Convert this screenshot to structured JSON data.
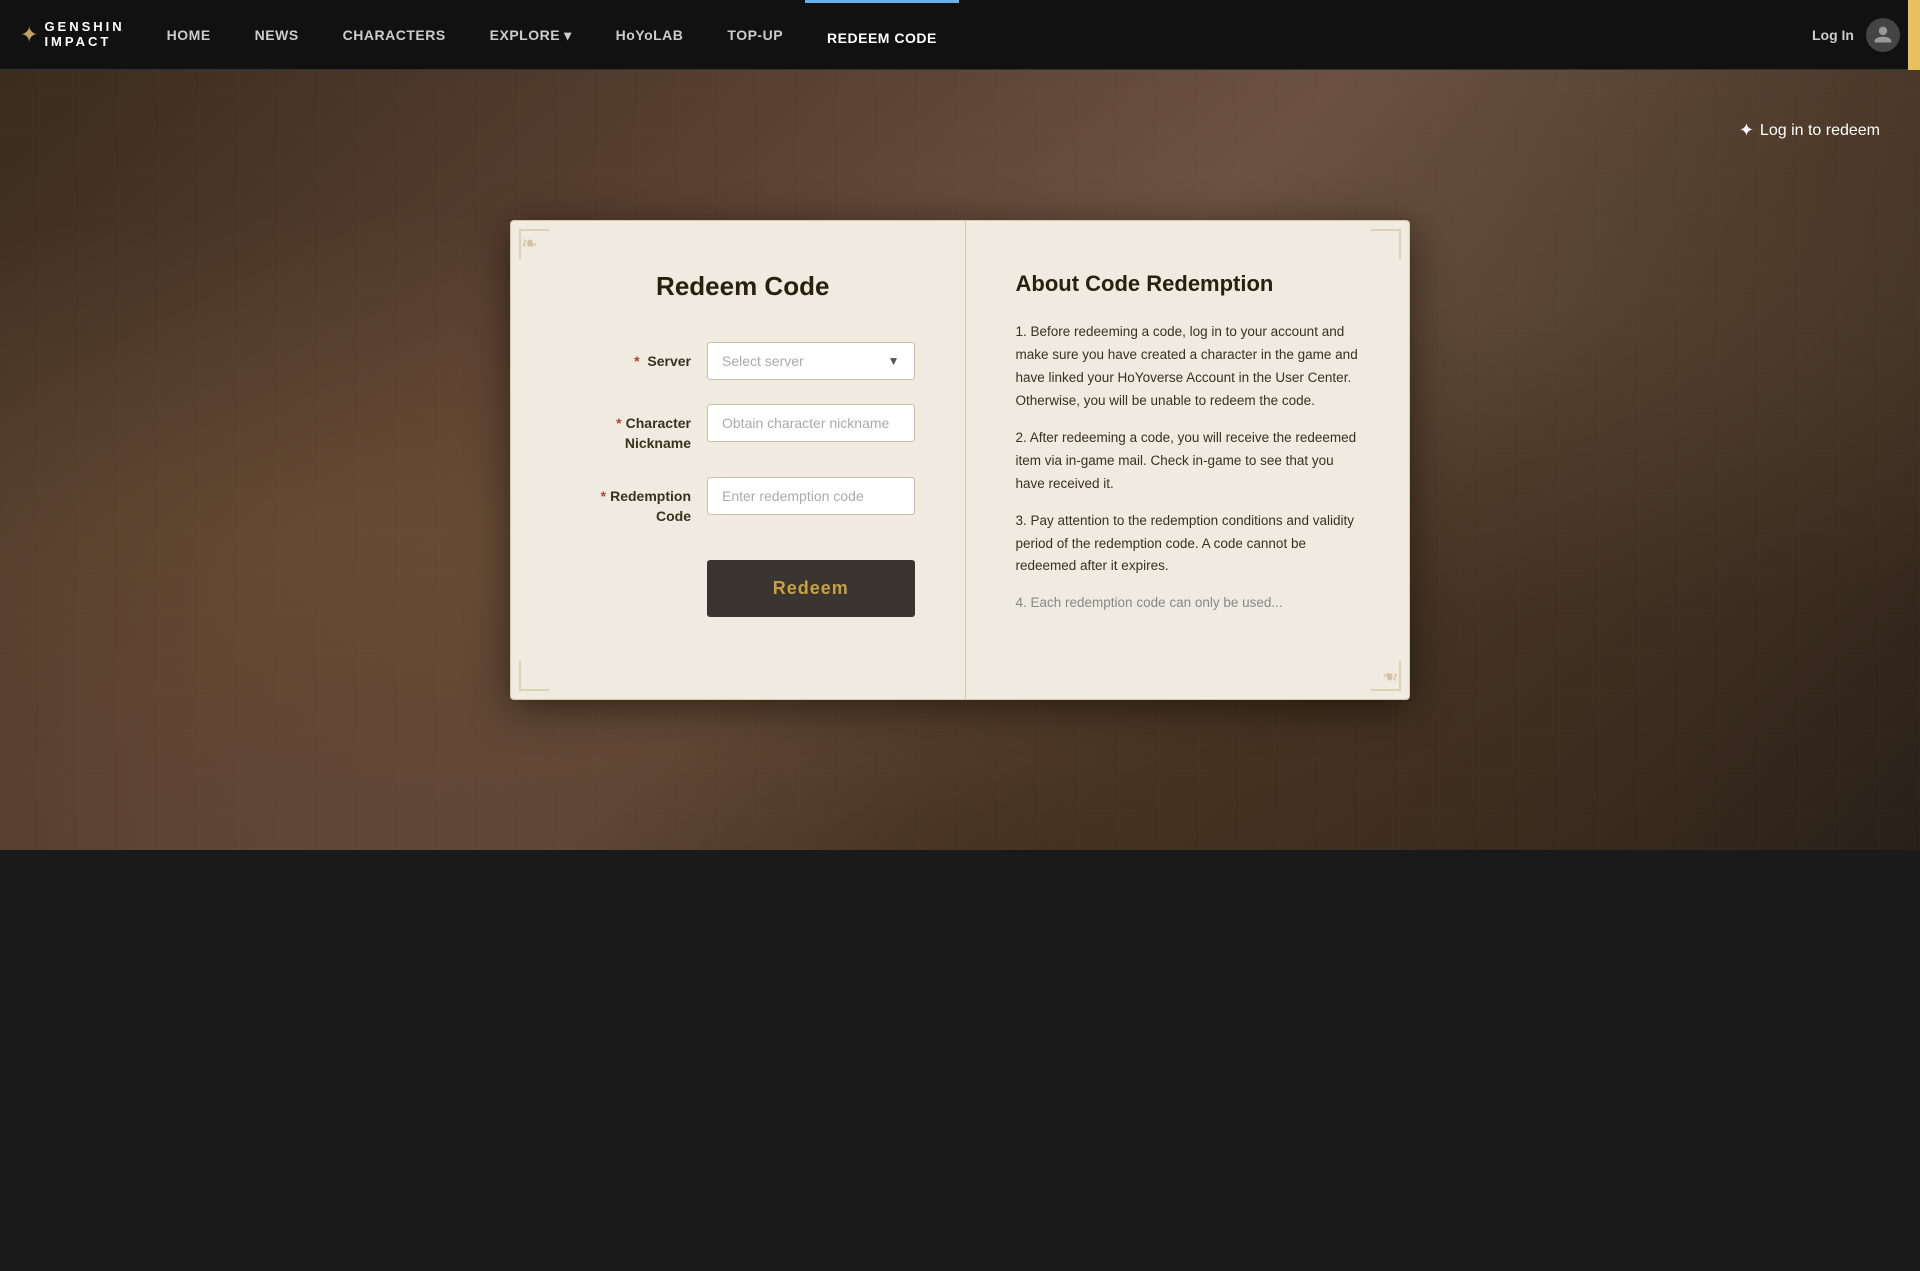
{
  "nav": {
    "logo_line1": "GENSHIN",
    "logo_line2": "IMPACT",
    "links": [
      {
        "id": "home",
        "label": "HOME",
        "active": false
      },
      {
        "id": "news",
        "label": "NEWS",
        "active": false
      },
      {
        "id": "characters",
        "label": "CHARACTERS",
        "active": false
      },
      {
        "id": "explore",
        "label": "EXPLORE",
        "active": false,
        "has_dropdown": true
      },
      {
        "id": "hoyolab",
        "label": "HoYoLAB",
        "active": false
      },
      {
        "id": "topup",
        "label": "TOP-UP",
        "active": false
      },
      {
        "id": "redeemcode",
        "label": "REDEEM CODE",
        "active": true
      }
    ],
    "login_label": "Log In",
    "avatar_icon": "person"
  },
  "hero": {
    "login_to_redeem": "Log in to redeem",
    "star_icon": "✦"
  },
  "card": {
    "title": "Redeem Code",
    "form": {
      "server_label": "Server",
      "server_placeholder": "Select server",
      "nickname_label": "Character\nNickname",
      "nickname_placeholder": "Obtain character nickname",
      "redemption_label": "Redemption\nCode",
      "redemption_placeholder": "Enter redemption code",
      "required_mark": "*",
      "redeem_button": "Redeem"
    },
    "about": {
      "title": "About Code Redemption",
      "points": [
        "1. Before redeeming a code, log in to your account and make sure you have created a character in the game and have linked your HoYoverse Account in the User Center. Otherwise, you will be unable to redeem the code.",
        "2. After redeeming a code, you will receive the redeemed item via in-game mail. Check in-game to see that you have received it.",
        "3. Pay attention to the redemption conditions and validity period of the redemption code. A code cannot be redeemed after it expires.",
        "4. Each redemption code can only be used"
      ],
      "point4_faded": "4. Each redemption code can only be used"
    }
  }
}
